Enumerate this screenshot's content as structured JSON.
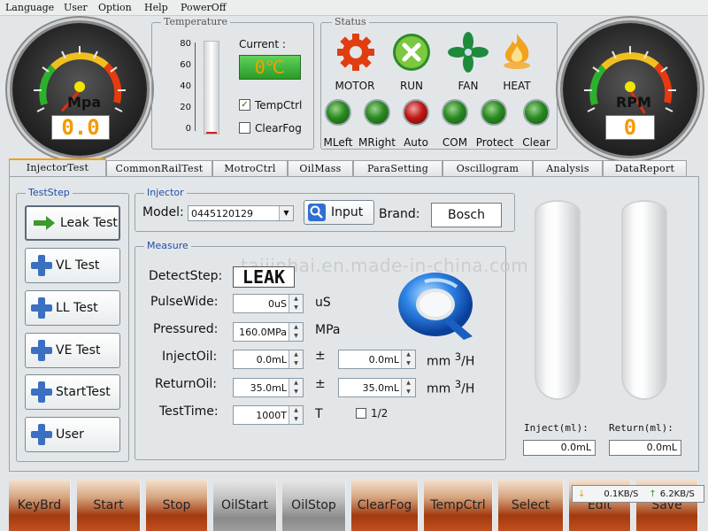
{
  "menu": [
    "Language",
    "User",
    "Option",
    "Help",
    "PowerOff"
  ],
  "gauges": {
    "left": {
      "unit": "Mpa",
      "value": "0.0",
      "level": 0.35
    },
    "right": {
      "unit": "RPM",
      "value": "0",
      "level": 0.62
    }
  },
  "temperature": {
    "legend": "Temperature",
    "scale": [
      "80",
      "60",
      "40",
      "20",
      "0"
    ],
    "current_label": "Current :",
    "current_value": "0℃",
    "tempctrl_label": "TempCtrl",
    "tempctrl_checked": true,
    "clearfog_label": "ClearFog",
    "clearfog_checked": false
  },
  "status": {
    "legend": "Status",
    "icons": [
      {
        "label": "MOTOR",
        "icon": "gear-icon"
      },
      {
        "label": "RUN",
        "icon": "x-icon"
      },
      {
        "label": "FAN",
        "icon": "fan-icon"
      },
      {
        "label": "HEAT",
        "icon": "flame-icon"
      }
    ],
    "leds": [
      {
        "label": "MLeft",
        "color": "green"
      },
      {
        "label": "MRight",
        "color": "green"
      },
      {
        "label": "Auto",
        "color": "red"
      },
      {
        "label": "COM",
        "color": "green"
      },
      {
        "label": "Protect",
        "color": "green"
      },
      {
        "label": "Clear",
        "color": "green"
      }
    ]
  },
  "tabs": [
    "InjectorTest",
    "CommonRailTest",
    "MotroCtrl",
    "OilMass",
    "ParaSetting",
    "Oscillogram",
    "Analysis",
    "DataReport"
  ],
  "active_tab": 0,
  "teststep": {
    "legend": "TestStep",
    "buttons": [
      "Leak Test",
      "VL Test",
      "LL Test",
      "VE Test",
      "StartTest",
      "User"
    ]
  },
  "injector": {
    "legend": "Injector",
    "model_label": "Model:",
    "model_value": "0445120129",
    "input_label": "Input",
    "brand_label": "Brand:",
    "brand_value": "Bosch"
  },
  "measure": {
    "legend": "Measure",
    "detect_label": "DetectStep:",
    "detect_value": "LEAK",
    "pulse_label": "PulseWide:",
    "pulse_value": "0uS",
    "pulse_unit": "uS",
    "pressured_label": "Pressured:",
    "pressured_value": "160.0MPa",
    "pressured_unit": "MPa",
    "inject_label": "InjectOil:",
    "inject_value": "0.0mL",
    "inject_tol": "0.0mL",
    "return_label": "ReturnOil:",
    "return_value": "35.0mL",
    "return_tol": "35.0mL",
    "pm": "±",
    "flow_unit": "mm",
    "flow_sup": "3",
    "flow_tail": "/H",
    "testtime_label": "TestTime:",
    "testtime_value": "1000T",
    "testtime_unit": "T",
    "half_label": "1/2",
    "watermark": "taijinhai.en.made-in-china.com"
  },
  "tubes": {
    "inject_label": "Inject(ml):",
    "inject_value": "0.0mL",
    "return_label": "Return(ml):",
    "return_value": "0.0mL"
  },
  "bottom": [
    "KeyBrd",
    "Start",
    "Stop",
    "OilStart",
    "OilStop",
    "ClearFog",
    "TempCtrl",
    "Select",
    "Edit",
    "Save"
  ],
  "network": {
    "down": "0.1KB/S",
    "up": "6.2KB/S"
  },
  "colors": {
    "accent": "#f0a020",
    "readout": "#f39a00",
    "link": "#1f4fa8"
  }
}
